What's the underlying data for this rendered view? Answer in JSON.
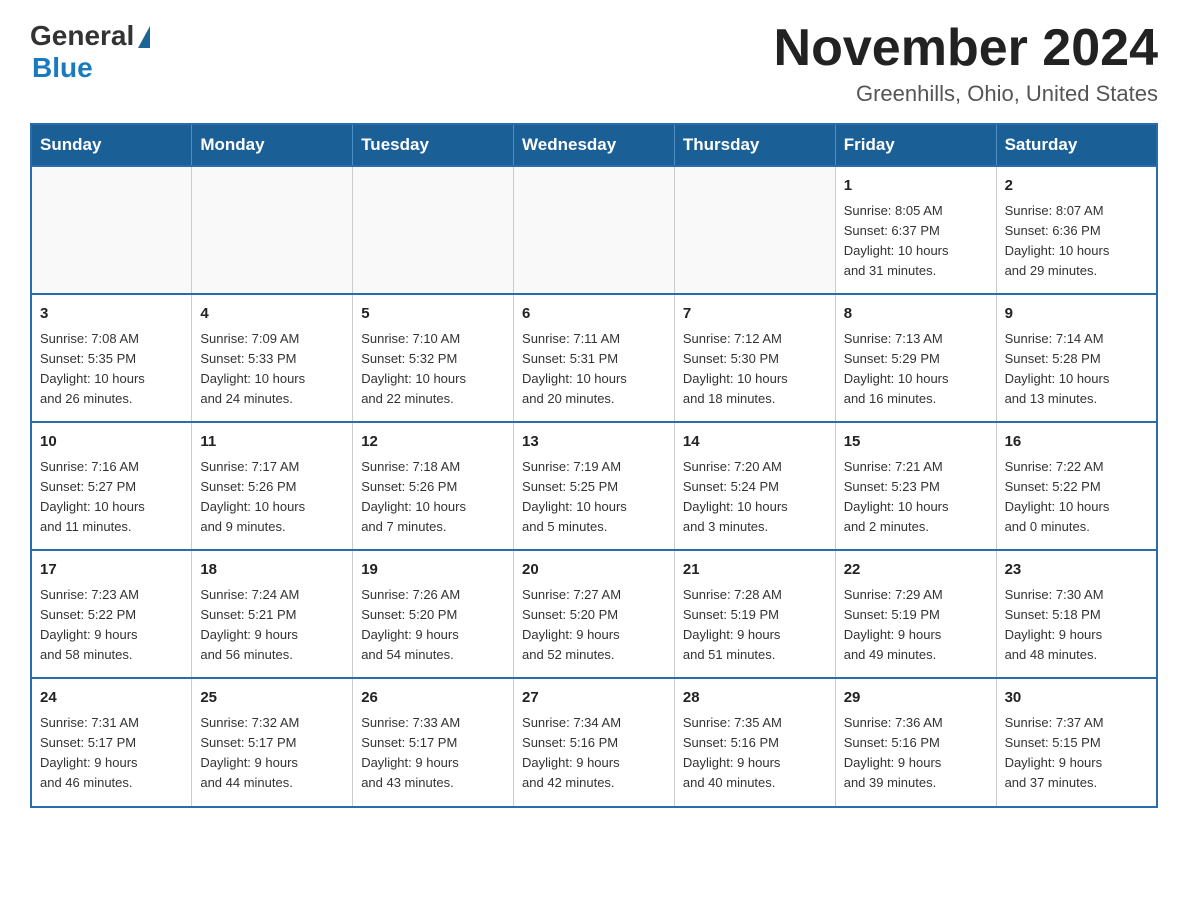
{
  "logo": {
    "general": "General",
    "blue": "Blue"
  },
  "title": "November 2024",
  "location": "Greenhills, Ohio, United States",
  "weekdays": [
    "Sunday",
    "Monday",
    "Tuesday",
    "Wednesday",
    "Thursday",
    "Friday",
    "Saturday"
  ],
  "weeks": [
    [
      {
        "day": "",
        "info": ""
      },
      {
        "day": "",
        "info": ""
      },
      {
        "day": "",
        "info": ""
      },
      {
        "day": "",
        "info": ""
      },
      {
        "day": "",
        "info": ""
      },
      {
        "day": "1",
        "info": "Sunrise: 8:05 AM\nSunset: 6:37 PM\nDaylight: 10 hours\nand 31 minutes."
      },
      {
        "day": "2",
        "info": "Sunrise: 8:07 AM\nSunset: 6:36 PM\nDaylight: 10 hours\nand 29 minutes."
      }
    ],
    [
      {
        "day": "3",
        "info": "Sunrise: 7:08 AM\nSunset: 5:35 PM\nDaylight: 10 hours\nand 26 minutes."
      },
      {
        "day": "4",
        "info": "Sunrise: 7:09 AM\nSunset: 5:33 PM\nDaylight: 10 hours\nand 24 minutes."
      },
      {
        "day": "5",
        "info": "Sunrise: 7:10 AM\nSunset: 5:32 PM\nDaylight: 10 hours\nand 22 minutes."
      },
      {
        "day": "6",
        "info": "Sunrise: 7:11 AM\nSunset: 5:31 PM\nDaylight: 10 hours\nand 20 minutes."
      },
      {
        "day": "7",
        "info": "Sunrise: 7:12 AM\nSunset: 5:30 PM\nDaylight: 10 hours\nand 18 minutes."
      },
      {
        "day": "8",
        "info": "Sunrise: 7:13 AM\nSunset: 5:29 PM\nDaylight: 10 hours\nand 16 minutes."
      },
      {
        "day": "9",
        "info": "Sunrise: 7:14 AM\nSunset: 5:28 PM\nDaylight: 10 hours\nand 13 minutes."
      }
    ],
    [
      {
        "day": "10",
        "info": "Sunrise: 7:16 AM\nSunset: 5:27 PM\nDaylight: 10 hours\nand 11 minutes."
      },
      {
        "day": "11",
        "info": "Sunrise: 7:17 AM\nSunset: 5:26 PM\nDaylight: 10 hours\nand 9 minutes."
      },
      {
        "day": "12",
        "info": "Sunrise: 7:18 AM\nSunset: 5:26 PM\nDaylight: 10 hours\nand 7 minutes."
      },
      {
        "day": "13",
        "info": "Sunrise: 7:19 AM\nSunset: 5:25 PM\nDaylight: 10 hours\nand 5 minutes."
      },
      {
        "day": "14",
        "info": "Sunrise: 7:20 AM\nSunset: 5:24 PM\nDaylight: 10 hours\nand 3 minutes."
      },
      {
        "day": "15",
        "info": "Sunrise: 7:21 AM\nSunset: 5:23 PM\nDaylight: 10 hours\nand 2 minutes."
      },
      {
        "day": "16",
        "info": "Sunrise: 7:22 AM\nSunset: 5:22 PM\nDaylight: 10 hours\nand 0 minutes."
      }
    ],
    [
      {
        "day": "17",
        "info": "Sunrise: 7:23 AM\nSunset: 5:22 PM\nDaylight: 9 hours\nand 58 minutes."
      },
      {
        "day": "18",
        "info": "Sunrise: 7:24 AM\nSunset: 5:21 PM\nDaylight: 9 hours\nand 56 minutes."
      },
      {
        "day": "19",
        "info": "Sunrise: 7:26 AM\nSunset: 5:20 PM\nDaylight: 9 hours\nand 54 minutes."
      },
      {
        "day": "20",
        "info": "Sunrise: 7:27 AM\nSunset: 5:20 PM\nDaylight: 9 hours\nand 52 minutes."
      },
      {
        "day": "21",
        "info": "Sunrise: 7:28 AM\nSunset: 5:19 PM\nDaylight: 9 hours\nand 51 minutes."
      },
      {
        "day": "22",
        "info": "Sunrise: 7:29 AM\nSunset: 5:19 PM\nDaylight: 9 hours\nand 49 minutes."
      },
      {
        "day": "23",
        "info": "Sunrise: 7:30 AM\nSunset: 5:18 PM\nDaylight: 9 hours\nand 48 minutes."
      }
    ],
    [
      {
        "day": "24",
        "info": "Sunrise: 7:31 AM\nSunset: 5:17 PM\nDaylight: 9 hours\nand 46 minutes."
      },
      {
        "day": "25",
        "info": "Sunrise: 7:32 AM\nSunset: 5:17 PM\nDaylight: 9 hours\nand 44 minutes."
      },
      {
        "day": "26",
        "info": "Sunrise: 7:33 AM\nSunset: 5:17 PM\nDaylight: 9 hours\nand 43 minutes."
      },
      {
        "day": "27",
        "info": "Sunrise: 7:34 AM\nSunset: 5:16 PM\nDaylight: 9 hours\nand 42 minutes."
      },
      {
        "day": "28",
        "info": "Sunrise: 7:35 AM\nSunset: 5:16 PM\nDaylight: 9 hours\nand 40 minutes."
      },
      {
        "day": "29",
        "info": "Sunrise: 7:36 AM\nSunset: 5:16 PM\nDaylight: 9 hours\nand 39 minutes."
      },
      {
        "day": "30",
        "info": "Sunrise: 7:37 AM\nSunset: 5:15 PM\nDaylight: 9 hours\nand 37 minutes."
      }
    ]
  ]
}
